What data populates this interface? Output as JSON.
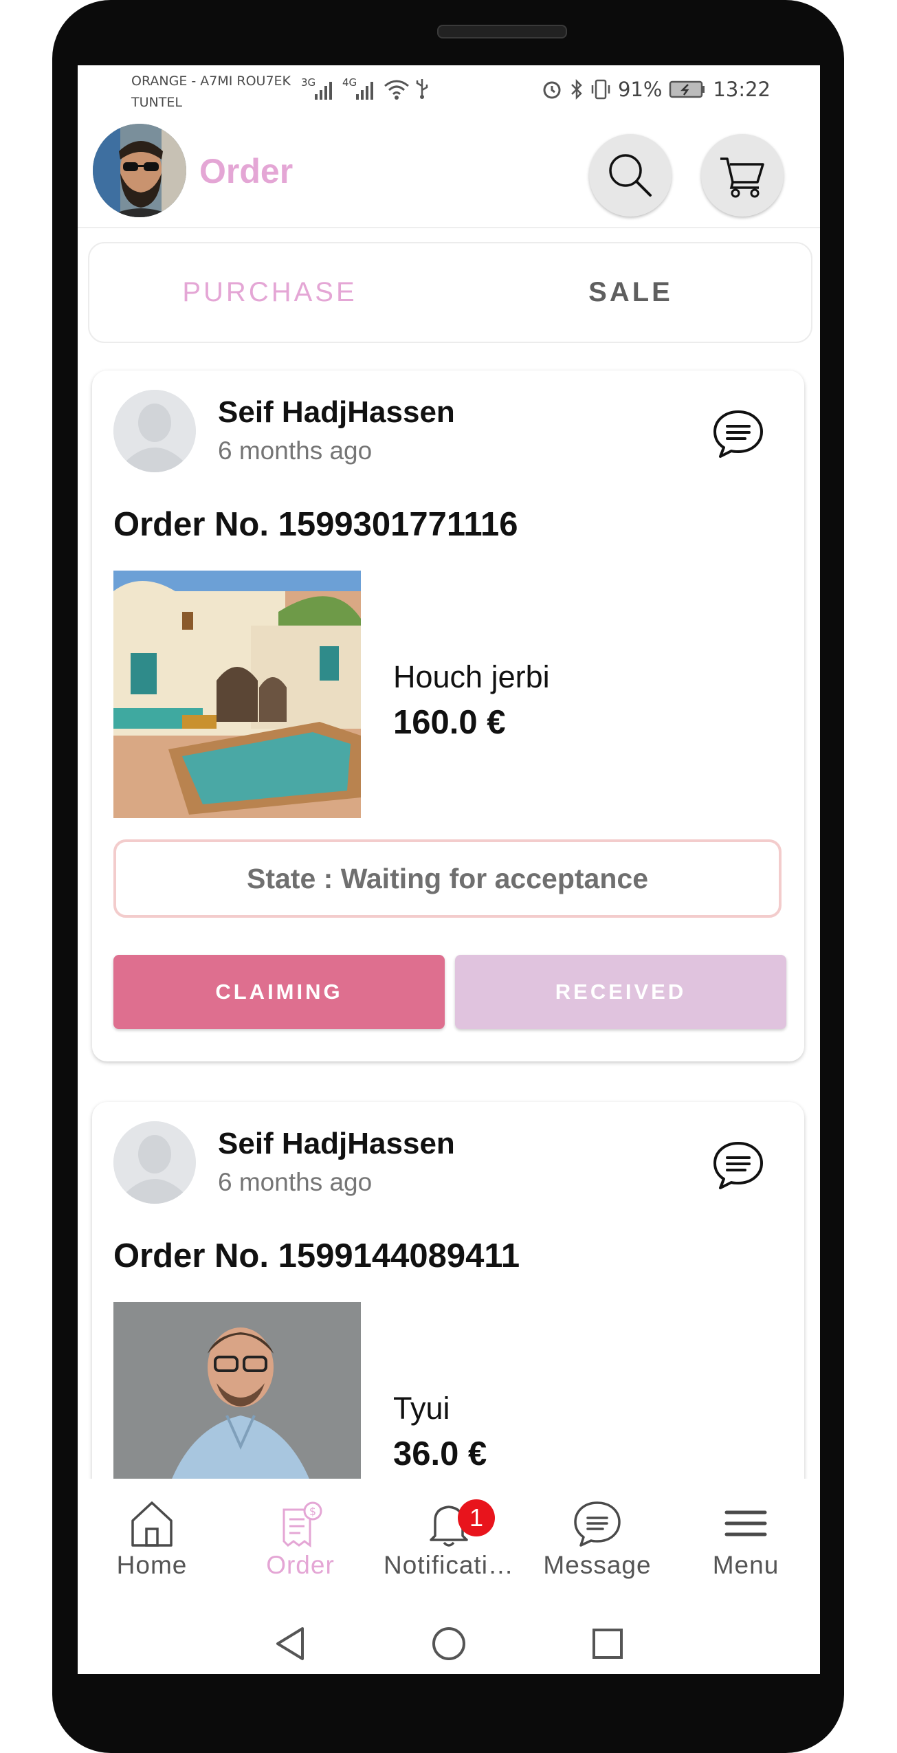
{
  "status_bar": {
    "carrier_line1": "ORANGE - A7MI ROU7EK",
    "carrier_line2": "TUNTEL",
    "sig1_label": "3G",
    "sig2_label": "4G",
    "battery": "91%",
    "time": "13:22"
  },
  "app_bar": {
    "title": "Order",
    "search_icon": "search-icon",
    "cart_icon": "cart-icon"
  },
  "tabs": [
    {
      "label": "PURCHASE",
      "active": true
    },
    {
      "label": "SALE",
      "active": false
    }
  ],
  "orders": [
    {
      "user": "Seif HadjHassen",
      "time": "6 months ago",
      "order_no": "Order No. 1599301771116",
      "product": "Houch jerbi",
      "price": "160.0 €",
      "state": "State : Waiting for acceptance",
      "claim_label": "CLAIMING",
      "received_label": "RECEIVED"
    },
    {
      "user": "Seif HadjHassen",
      "time": "6 months ago",
      "order_no": "Order No. 1599144089411",
      "product": "Tyui",
      "price": "36.0 €"
    }
  ],
  "bottom_nav": [
    {
      "label": "Home",
      "icon": "home-icon",
      "active": false
    },
    {
      "label": "Order",
      "icon": "order-icon",
      "active": true
    },
    {
      "label": "Notificati…",
      "icon": "bell-icon",
      "active": false,
      "badge": "1"
    },
    {
      "label": "Message",
      "icon": "message-icon",
      "active": false
    },
    {
      "label": "Menu",
      "icon": "menu-icon",
      "active": false
    }
  ],
  "colors": {
    "accent_pink": "#e4a6d5",
    "claim_button": "#de6f8f",
    "received_button": "#e0c3de",
    "state_border": "#f3cccc",
    "badge_red": "#e8141c"
  }
}
